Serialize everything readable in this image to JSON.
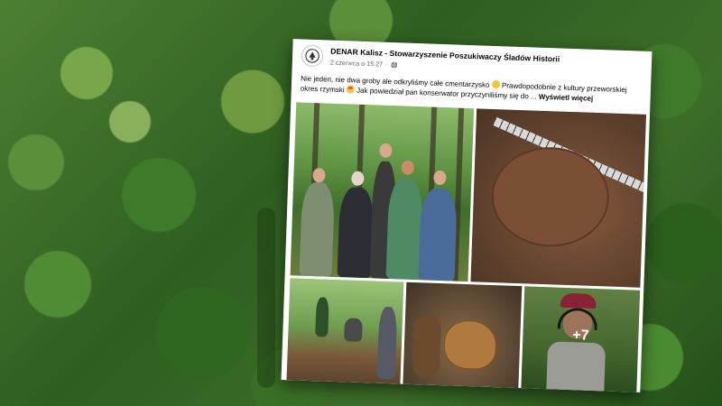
{
  "post": {
    "page_name": "DENAR Kalisz - Stowarzyszenie Poszukiwaczy Śladów Historii",
    "date": "2 czerwca o 15:27",
    "separator": "·",
    "text_part1": "Nie jeden, nie dwa groby ale odkryliśmy całe cmentarzysko",
    "text_part2": "Prawdopodobnie z kultury przeworskiej okres rzymski",
    "text_part3": "Jak powiedział pan konserwator przyczyniliśmy się do ...",
    "see_more": "Wyświetl więcej",
    "more_photos": "+7"
  },
  "icons": {
    "avatar": "society-logo-icon",
    "privacy": "globe-icon",
    "emoji1": "smiling-face-emoji",
    "emoji2": "heart-eyes-emoji"
  },
  "colors": {
    "page_name": "#050505",
    "meta": "#65676b",
    "card_bg": "#ffffff"
  }
}
